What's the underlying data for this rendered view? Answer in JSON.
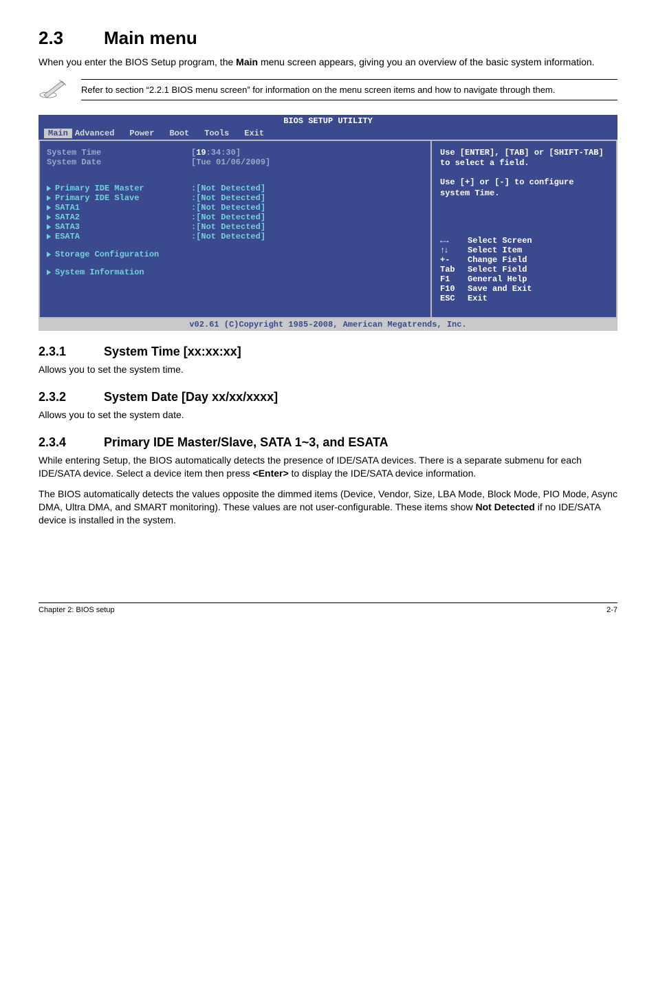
{
  "page": {
    "heading_num": "2.3",
    "heading_text": "Main menu",
    "intro_1": "When you enter the BIOS Setup program, the ",
    "intro_bold": "Main",
    "intro_2": " menu screen appears, giving you an overview of the basic system information.",
    "note": "Refer to section “2.2.1 BIOS menu screen” for information on the menu screen items and how to navigate through them."
  },
  "bios": {
    "title": "BIOS SETUP UTILITY",
    "tabs": {
      "main": "Main",
      "advanced": "Advanced",
      "power": "Power",
      "boot": "Boot",
      "tools": "Tools",
      "exit": "Exit"
    },
    "left": {
      "system_time_label": "System Time",
      "system_time_value": "[19:34:30]",
      "system_date_label": "System Date",
      "system_date_value": "[Tue 01/06/2009]",
      "items": [
        {
          "label": "Primary IDE Master",
          "value": ":[Not Detected]"
        },
        {
          "label": "Primary IDE Slave",
          "value": ":[Not Detected]"
        },
        {
          "label": "SATA1",
          "value": ":[Not Detected]"
        },
        {
          "label": "SATA2",
          "value": ":[Not Detected]"
        },
        {
          "label": "SATA3",
          "value": ":[Not Detected]"
        },
        {
          "label": "ESATA",
          "value": ":[Not Detected]"
        }
      ],
      "storage": "Storage Configuration",
      "sysinfo": "System Information"
    },
    "right": {
      "help1": "Use [ENTER], [TAB] or [SHIFT-TAB] to select a field.",
      "help2": "Use [+] or [-] to configure system Time.",
      "keys": {
        "lr": "Select Screen",
        "ud": "Select Item",
        "pm_k": "+-",
        "pm": "Change Field",
        "tab_k": "Tab",
        "tab": "Select Field",
        "f1_k": "F1",
        "f1": "General Help",
        "f10_k": "F10",
        "f10": "Save and Exit",
        "esc_k": "ESC",
        "esc": "Exit"
      }
    },
    "footer": "v02.61 (C)Copyright 1985-2008, American Megatrends, Inc."
  },
  "s231": {
    "num": "2.3.1",
    "title": "System Time [xx:xx:xx]",
    "body": "Allows you to set the system time."
  },
  "s232": {
    "num": "2.3.2",
    "title": "System Date [Day xx/xx/xxxx]",
    "body": "Allows you to set the system date."
  },
  "s234": {
    "num": "2.3.4",
    "title": "Primary IDE Master/Slave, SATA 1~3, and ESATA",
    "p1a": "While entering Setup, the BIOS automatically detects the presence of IDE/SATA devices. There is a separate submenu for each IDE/SATA device. Select a device item then press ",
    "p1bold": "<Enter>",
    "p1b": " to display the IDE/SATA device information.",
    "p2a": "The BIOS automatically detects the values opposite the dimmed items (Device, Vendor, Size, LBA Mode, Block Mode, PIO Mode, Async DMA, Ultra DMA, and SMART monitoring). These values are not user-configurable. These items show ",
    "p2bold": "Not Detected",
    "p2b": " if no IDE/SATA device is installed in the system."
  },
  "footer": {
    "left": "Chapter 2: BIOS setup",
    "right": "2-7"
  }
}
